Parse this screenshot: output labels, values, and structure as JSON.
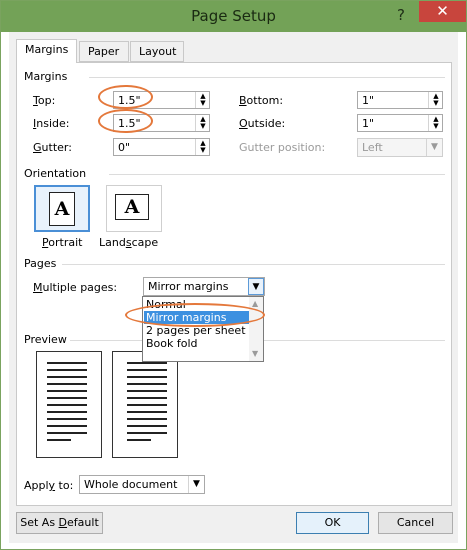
{
  "window": {
    "title": "Page Setup",
    "help_glyph": "?",
    "close_glyph": "✕"
  },
  "tabs": [
    {
      "label": "Margins",
      "active": true
    },
    {
      "label": "Paper",
      "active": false
    },
    {
      "label": "Layout",
      "active": false
    }
  ],
  "margins": {
    "section_title": "Margins",
    "top": {
      "label_u": "T",
      "label_rest": "op:",
      "value": "1.5\""
    },
    "bottom": {
      "label_u": "B",
      "label_rest": "ottom:",
      "value": "1\""
    },
    "inside": {
      "label_u": "I",
      "label_rest": "nside:",
      "value": "1.5\""
    },
    "outside": {
      "label_u": "O",
      "label_rest": "utside:",
      "value": "1\""
    },
    "gutter": {
      "label_u": "G",
      "label_rest": "utter:",
      "value": "0\""
    },
    "gutter_position": {
      "label": "Gutter position:",
      "value": "Left",
      "disabled": true
    }
  },
  "orientation": {
    "section_title": "Orientation",
    "portrait": {
      "label_u": "P",
      "label_rest": "ortrait",
      "glyph": "A",
      "selected": true
    },
    "landscape": {
      "label_u": "s",
      "label_pre": "Land",
      "label_rest": "cape",
      "glyph": "A",
      "selected": false
    }
  },
  "pages": {
    "section_title": "Pages",
    "multiple_pages_label_u": "M",
    "multiple_pages_label_rest": "ultiple pages:",
    "selected_value": "Mirror margins",
    "options": [
      "Normal",
      "Mirror margins",
      "2 pages per sheet",
      "Book fold"
    ],
    "highlighted_index": 1
  },
  "preview": {
    "section_title": "Preview"
  },
  "apply_to": {
    "label_pre": "Appl",
    "label_u": "y",
    "label_rest": " to:",
    "value": "Whole document"
  },
  "buttons": {
    "set_default_pre": "Set As ",
    "set_default_u": "D",
    "set_default_rest": "efault",
    "ok": "OK",
    "cancel": "Cancel"
  },
  "colors": {
    "titlebar": "#73a257",
    "close": "#c8453d",
    "highlight": "#3c90e0",
    "annotation": "#e4783b"
  }
}
